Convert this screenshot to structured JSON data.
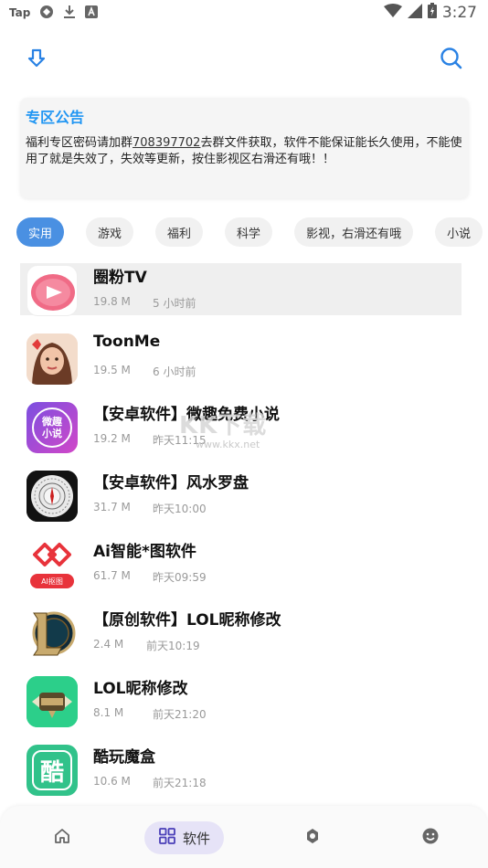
{
  "status_bar": {
    "left_text": "Tap",
    "time": "3:27",
    "icons": [
      "app-icon",
      "download-icon",
      "font-icon",
      "wifi-icon",
      "signal-icon",
      "battery-icon"
    ]
  },
  "header": {
    "left_icon": "download-arrow-icon",
    "right_icon": "search-icon"
  },
  "notice": {
    "title": "专区公告",
    "body_prefix": "福利专区密码请加群",
    "group_number": "708397702",
    "body_suffix": "去群文件获取，软件不能保证能长久使用，不能使用了就是失效了，失效等更新，按住影视区右滑还有哦！！"
  },
  "tabs": [
    {
      "label": "实用",
      "active": true
    },
    {
      "label": "游戏",
      "active": false
    },
    {
      "label": "福利",
      "active": false
    },
    {
      "label": "科学",
      "active": false
    },
    {
      "label": "影视，右滑还有哦",
      "active": false
    },
    {
      "label": "小说",
      "active": false
    }
  ],
  "apps": [
    {
      "name": "圈粉TV",
      "size": "19.8 M",
      "time": "5 小时前"
    },
    {
      "name": "ToonMe",
      "size": "19.5 M",
      "time": "6 小时前"
    },
    {
      "name": "【安卓软件】微趣免费小说",
      "size": "19.2 M",
      "time": "昨天11:15",
      "icon_text": "微趣\n小说"
    },
    {
      "name": "【安卓软件】风水罗盘",
      "size": "31.7 M",
      "time": "昨天10:00"
    },
    {
      "name": "Ai智能*图软件",
      "size": "61.7 M",
      "time": "昨天09:59",
      "icon_text": "AI抠图"
    },
    {
      "name": "【原创软件】LOL昵称修改",
      "size": "2.4 M",
      "time": "前天10:19"
    },
    {
      "name": "LOL昵称修改",
      "size": "8.1 M",
      "time": "前天21:20"
    },
    {
      "name": "酷玩魔盒",
      "size": "10.6 M",
      "time": "前天21:18",
      "icon_text": "酷"
    }
  ],
  "watermark": {
    "big": "KK下载",
    "small": "www.kkx.net"
  },
  "bottom_nav": {
    "home_icon": "home-icon",
    "software_label": "软件",
    "software_icon": "grid-icon",
    "discover_icon": "discover-icon",
    "me_icon": "smile-icon"
  },
  "colors": {
    "accent": "#4A90E2",
    "notice_title": "#2196F3",
    "nav_active_bg": "#e6e3f7"
  }
}
